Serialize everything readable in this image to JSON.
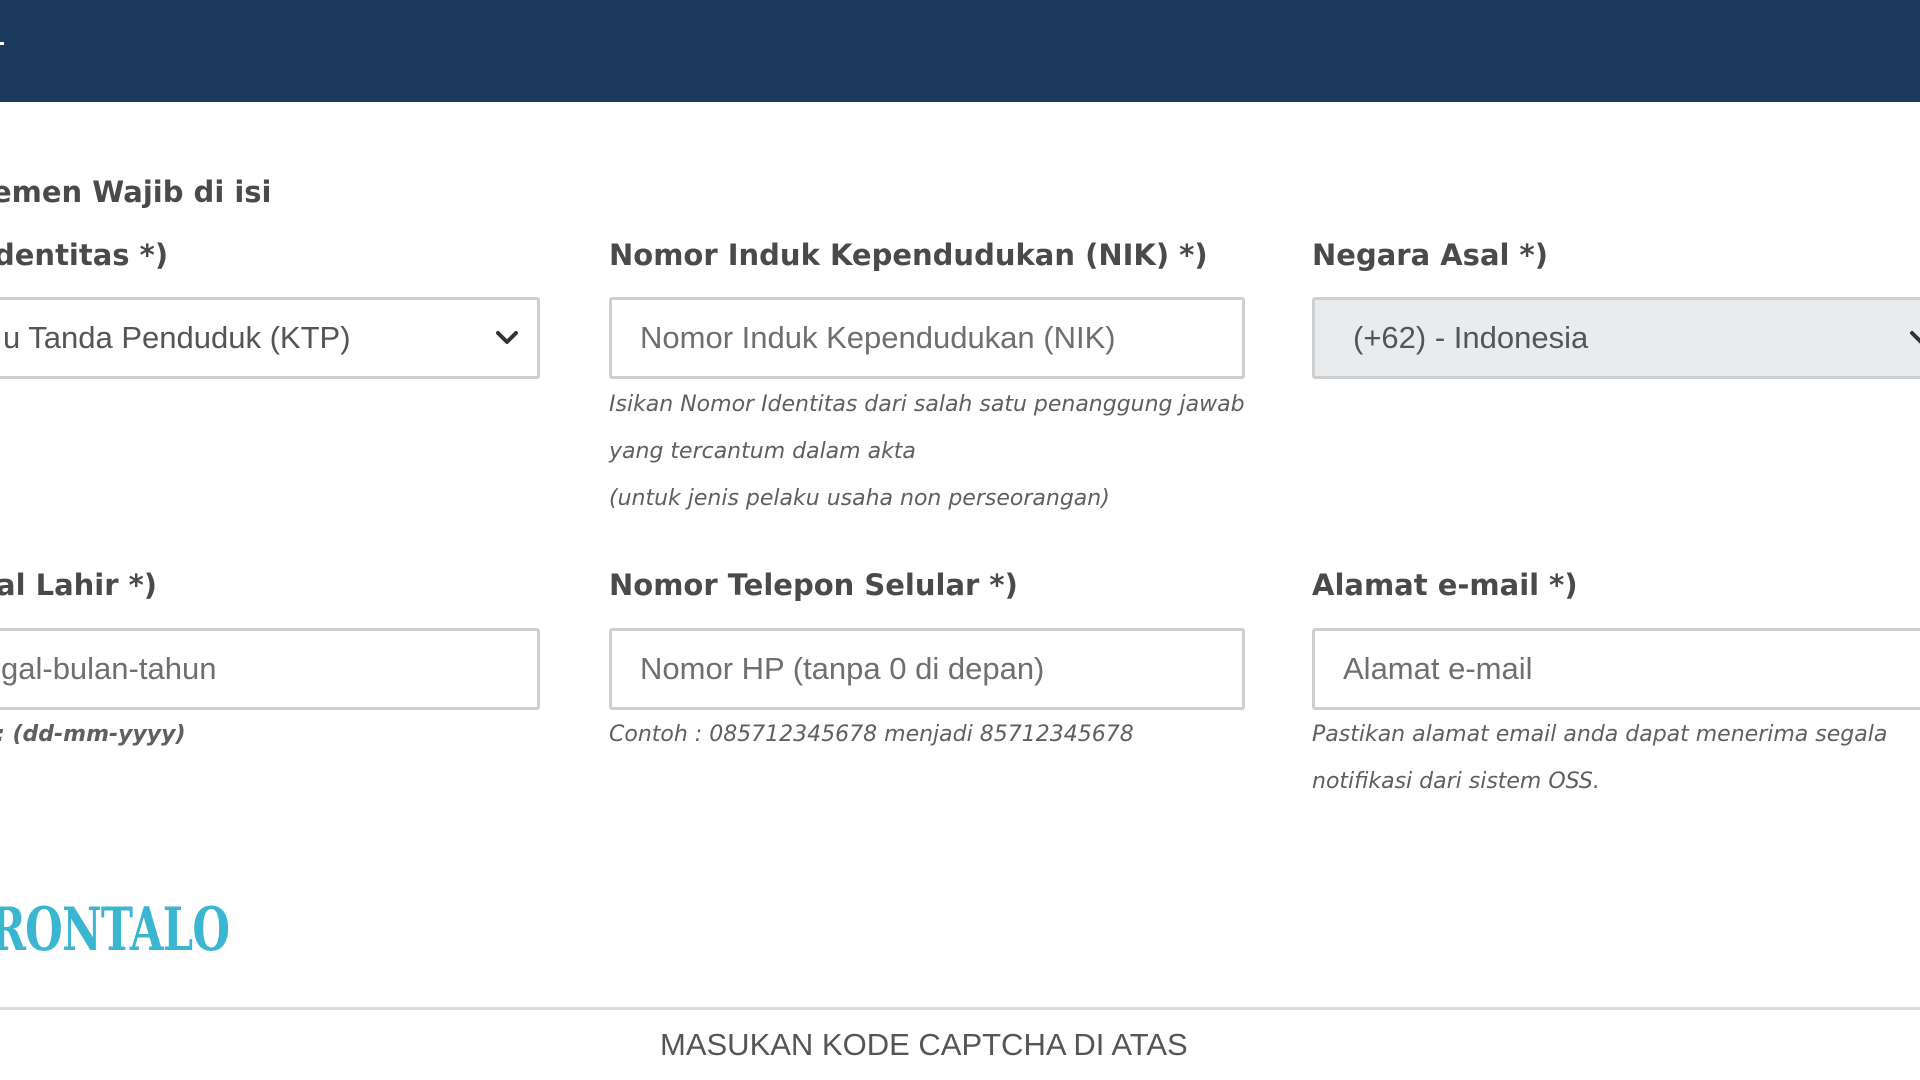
{
  "section": {
    "title": "emen Wajib di isi"
  },
  "identity_type": {
    "label": "dentitas *)",
    "value": "u Tanda Penduduk (KTP)",
    "icon": "chevron-down-icon"
  },
  "nik": {
    "label": "Nomor Induk Kependudukan (NIK) *)",
    "placeholder": "Nomor Induk Kependudukan (NIK)",
    "help_lines": [
      "Isikan Nomor Identitas dari salah satu penanggung jawab",
      "yang tercantum dalam akta",
      "(untuk jenis pelaku usaha non perseorangan)"
    ]
  },
  "country": {
    "label": "Negara Asal *)",
    "value": "(+62) - Indonesia",
    "icon": "chevron-down-icon"
  },
  "birth_date": {
    "label": "al Lahir *)",
    "placeholder": "gal-bulan-tahun",
    "help": ": (dd-mm-yyyy)"
  },
  "phone": {
    "label": "Nomor Telepon Selular *)",
    "placeholder": "Nomor HP (tanpa 0 di depan)",
    "help": "Contoh : 085712345678 menjadi 85712345678"
  },
  "email": {
    "label": "Alamat e-mail *)",
    "placeholder": "Alamat e-mail",
    "help_lines": [
      "Pastikan alamat email anda dapat menerima segala",
      "notifikasi dari sistem OSS."
    ]
  },
  "captcha": {
    "image_text": "RONTALO",
    "placeholder": "MASUKAN KODE CAPTCHA DI ATAS"
  },
  "colors": {
    "header_bg": "#1b3a5c",
    "captcha_text": "#3bb6d1"
  }
}
